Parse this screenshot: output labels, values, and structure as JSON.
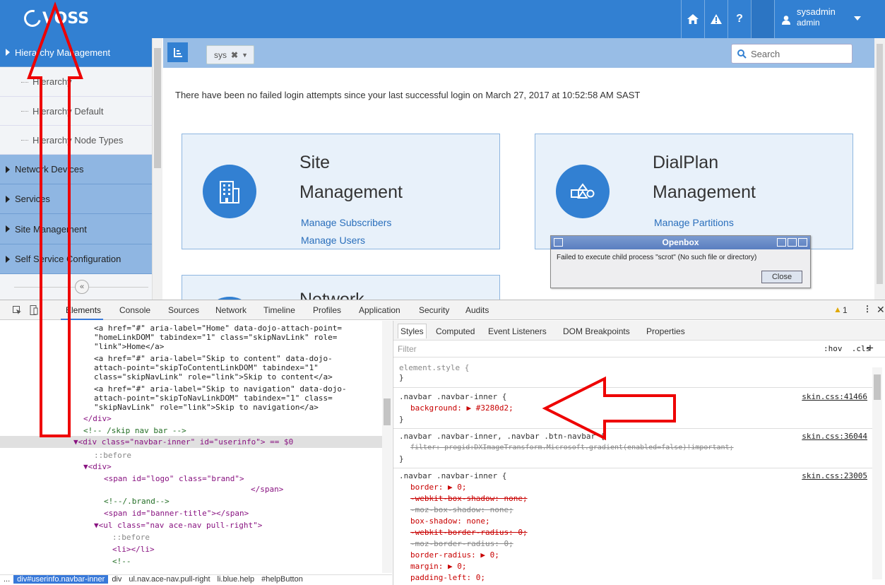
{
  "navbar": {
    "logo_text": "VOSS",
    "color": "#3280d2",
    "icons": [
      "home-icon",
      "warning-icon",
      "help-icon"
    ],
    "help_label": "?",
    "username": "sysadmin",
    "role": "admin"
  },
  "sidebar": {
    "items": [
      {
        "label": "Hierarchy Management",
        "active": true
      },
      {
        "label": "Hierarchy"
      },
      {
        "label": "Hierarchy Default"
      },
      {
        "label": "Hierarchy Node Types"
      },
      {
        "label": "Network Devices"
      },
      {
        "label": "Services"
      },
      {
        "label": "Site Management"
      },
      {
        "label": "Self Service Configuration"
      }
    ],
    "collapse_label": "«"
  },
  "toolbar": {
    "tree_icon": "tree-icon",
    "hierarchy_value": "sys",
    "search_placeholder": "Search"
  },
  "main": {
    "login_message": "There have been no failed login attempts since your last successful login on March 27, 2017 at 10:52:58 AM SAST",
    "tiles": [
      {
        "title1": "Site",
        "title2": "Management",
        "links": [
          "Manage Subscribers",
          "Manage Users"
        ]
      },
      {
        "title1": "DialPlan",
        "title2": "Management",
        "links": [
          "Manage Partitions"
        ]
      },
      {
        "title1": "Network"
      }
    ]
  },
  "openbox": {
    "title": "Openbox",
    "message": "Failed to execute child process \"scrot\" (No such file or directory)",
    "close_label": "Close"
  },
  "devtools": {
    "tabs": [
      "Elements",
      "Console",
      "Sources",
      "Network",
      "Timeline",
      "Profiles",
      "Application",
      "Security",
      "Audits"
    ],
    "warning_count": "1",
    "style_tabs": [
      "Styles",
      "Computed",
      "Event Listeners",
      "DOM Breakpoints",
      "Properties"
    ],
    "filter_placeholder": "Filter",
    "hov_cls": ":hov  .cls",
    "breadcrumbs": [
      "...",
      "div#userinfo.navbar-inner",
      "div",
      "ul.nav.ace-nav.pull-right",
      "li.blue.help",
      "#helpButton"
    ],
    "elements_lines": [
      "<a href=\"#\" aria-label=\"Home\" data-dojo-attach-point=",
      "\"homeLinkDOM\" tabindex=\"1\" class=\"skipNavLink\" role=",
      "\"link\">Home</a>",
      "<a href=\"#\" aria-label=\"Skip to content\" data-dojo-",
      "attach-point=\"skipToContentLinkDOM\" tabindex=\"1\"",
      "class=\"skipNavLink\" role=\"link\">Skip to content</a>",
      "<a href=\"#\" aria-label=\"Skip to navigation\" data-dojo-",
      "attach-point=\"skipToNavLinkDOM\" tabindex=\"1\" class=",
      "\"skipNavLink\" role=\"link\">Skip to navigation</a>",
      "</div>",
      "<!-- /skip nav bar -->",
      "▼<div class=\"navbar-inner\" id=\"userinfo\"> == $0",
      "::before",
      "▼<div>",
      "<span id=\"logo\" class=\"brand\">",
      "</span>",
      "<!--/.brand-->",
      "<span id=\"banner-title\"></span>",
      "▼<ul class=\"nav ace-nav pull-right\">",
      "::before",
      "<li></li>",
      "<!--"
    ],
    "styles": [
      {
        "selector": "element.style {",
        "close": "}"
      },
      {
        "selector": ".navbar .navbar-inner {",
        "src": "skin.css:41466",
        "props": [
          "background: ▶ #3280d2;"
        ]
      },
      {
        "selector": ".navbar .navbar-inner, .navbar .btn-navbar {",
        "src": "skin.css:36044",
        "props": [
          "filter: progid:DXImageTransform.Microsoft.gradient(enabled=false)!important;"
        ]
      },
      {
        "selector": ".navbar .navbar-inner {",
        "src": "skin.css:23005",
        "props": [
          "border: ▶ 0;",
          "-webkit-box-shadow: none;",
          "-moz-box-shadow: none;",
          "box-shadow: none;",
          "-webkit-border-radius: 0;",
          "-moz-border-radius: 0;",
          "border-radius: ▶ 0;",
          "margin: ▶ 0;",
          "padding-left: 0;"
        ]
      }
    ]
  }
}
